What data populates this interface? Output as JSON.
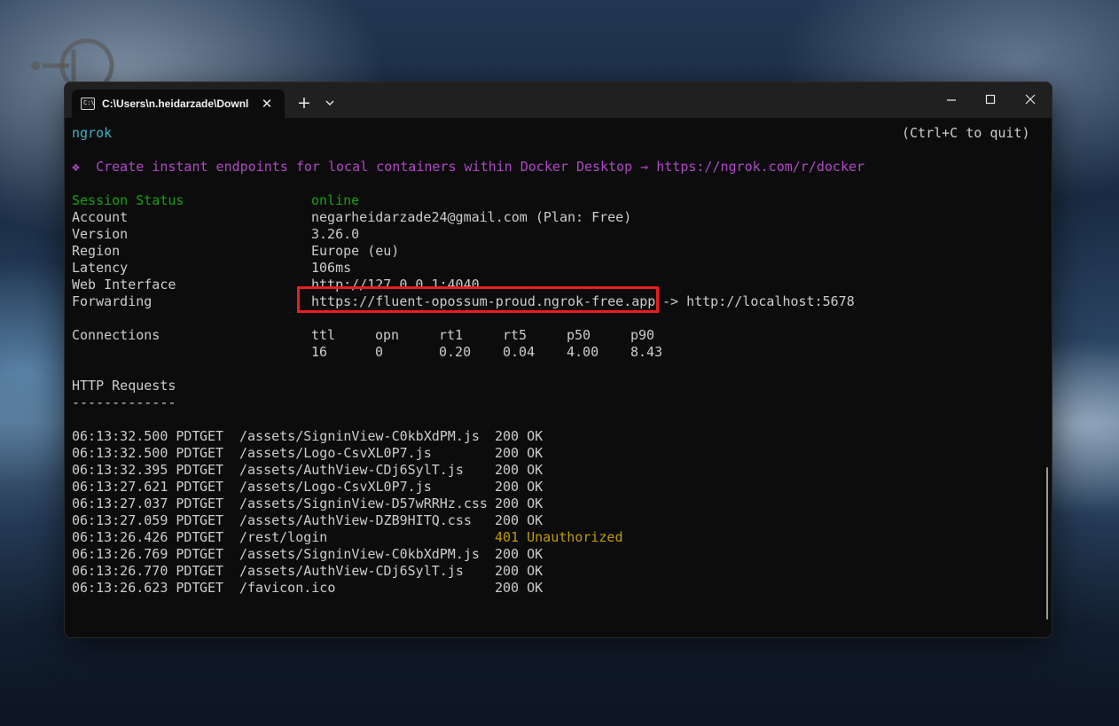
{
  "window": {
    "tab_title": "C:\\Users\\n.heidarzade\\Downloads",
    "tab_icon_label": "C:\\",
    "close_tab_glyph": "✕",
    "new_tab_glyph": "+",
    "icons": {
      "tab": "terminal-icon",
      "dropdown": "chevron-down-icon",
      "minimize": "minimize-icon",
      "maximize": "maximize-icon",
      "close": "close-icon"
    }
  },
  "terminal": {
    "app_name": "ngrok",
    "quit_hint": "(Ctrl+C to quit)",
    "banner": "❖  Create instant endpoints for local containers within Docker Desktop → https://ngrok.com/r/docker",
    "session": [
      {
        "label": "Session Status",
        "value": "online"
      },
      {
        "label": "Account",
        "value": "negarheidarzade24@gmail.com (Plan: Free)"
      },
      {
        "label": "Version",
        "value": "3.26.0"
      },
      {
        "label": "Region",
        "value": "Europe (eu)"
      },
      {
        "label": "Latency",
        "value": "106ms"
      },
      {
        "label": "Web Interface",
        "value": "http://127.0.0.1:4040"
      },
      {
        "label": "Forwarding",
        "value": "https://fluent-opossum-proud.ngrok-free.app",
        "target": "-> http://localhost:5678"
      }
    ],
    "connections": {
      "label": "Connections",
      "headers": [
        "ttl",
        "opn",
        "rt1",
        "rt5",
        "p50",
        "p90"
      ],
      "values": [
        "16",
        "0",
        "0.20",
        "0.04",
        "4.00",
        "8.43"
      ]
    },
    "http_requests": {
      "title": "HTTP Requests",
      "underline": "-------------",
      "rows": [
        {
          "time": "06:13:32.500 PDT",
          "method": "GET",
          "path": "/assets/SigninView-C0kbXdPM.js",
          "status": "200 OK"
        },
        {
          "time": "06:13:32.500 PDT",
          "method": "GET",
          "path": "/assets/Logo-CsvXL0P7.js",
          "status": "200 OK"
        },
        {
          "time": "06:13:32.395 PDT",
          "method": "GET",
          "path": "/assets/AuthView-CDj6SylT.js",
          "status": "200 OK"
        },
        {
          "time": "06:13:27.621 PDT",
          "method": "GET",
          "path": "/assets/Logo-CsvXL0P7.js",
          "status": "200 OK"
        },
        {
          "time": "06:13:27.037 PDT",
          "method": "GET",
          "path": "/assets/SigninView-D57wRRHz.css",
          "status": "200 OK"
        },
        {
          "time": "06:13:27.059 PDT",
          "method": "GET",
          "path": "/assets/AuthView-DZB9HITQ.css",
          "status": "200 OK"
        },
        {
          "time": "06:13:26.426 PDT",
          "method": "GET",
          "path": "/rest/login",
          "status": "401 Unauthorized",
          "error": true
        },
        {
          "time": "06:13:26.769 PDT",
          "method": "GET",
          "path": "/assets/SigninView-C0kbXdPM.js",
          "status": "200 OK"
        },
        {
          "time": "06:13:26.770 PDT",
          "method": "GET",
          "path": "/assets/AuthView-CDj6SylT.js",
          "status": "200 OK"
        },
        {
          "time": "06:13:26.623 PDT",
          "method": "GET",
          "path": "/favicon.ico",
          "status": "200 OK"
        }
      ]
    }
  },
  "colors": {
    "terminal_bg": "#0c0c0c",
    "text": "#cccccc",
    "app_name": "#3fb3c3",
    "banner": "#b148c6",
    "status_online": "#13a10e",
    "error_status": "#c19c00",
    "highlight_box": "#e81e22"
  }
}
